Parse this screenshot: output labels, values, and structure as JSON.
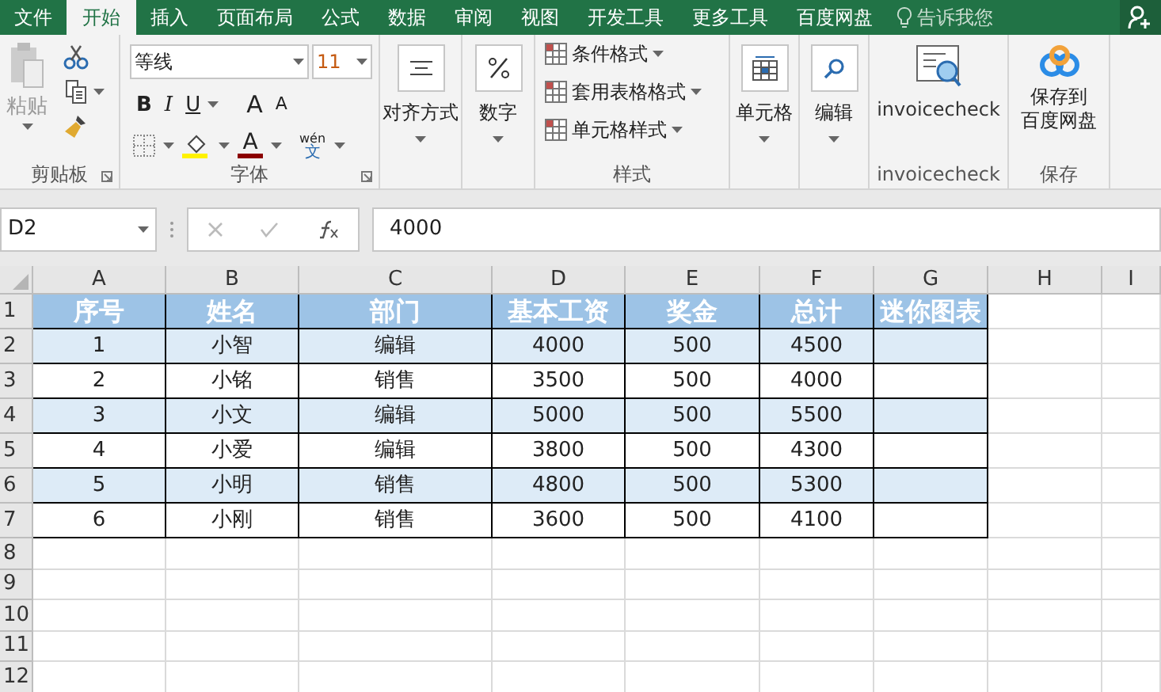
{
  "tabs": [
    {
      "label": "文件",
      "selected": false
    },
    {
      "label": "开始",
      "selected": true
    },
    {
      "label": "插入",
      "selected": false
    },
    {
      "label": "页面布局",
      "selected": false
    },
    {
      "label": "公式",
      "selected": false
    },
    {
      "label": "数据",
      "selected": false
    },
    {
      "label": "审阅",
      "selected": false
    },
    {
      "label": "视图",
      "selected": false
    },
    {
      "label": "开发工具",
      "selected": false
    },
    {
      "label": "更多工具",
      "selected": false
    },
    {
      "label": "百度网盘",
      "selected": false
    }
  ],
  "tell_me": "告诉我您",
  "ribbon": {
    "clipboard": {
      "paste": "粘贴",
      "label": "剪贴板"
    },
    "font": {
      "name": "等线",
      "size": "11",
      "bold": "B",
      "italic": "I",
      "underline": "U",
      "grow": "A",
      "shrink": "A",
      "font_color": "A",
      "phonetic_top": "wén",
      "phonetic_bottom": "文",
      "label": "字体"
    },
    "alignment": "对齐方式",
    "number": "数字",
    "styles": {
      "items": [
        "条件格式",
        "套用表格格式",
        "单元格样式"
      ],
      "label": "样式"
    },
    "cells": "单元格",
    "editing": "编辑",
    "invoicecheck": {
      "button": "invoicecheck",
      "label": "invoicecheck"
    },
    "save": {
      "button_line1": "保存到",
      "button_line2": "百度网盘",
      "label": "保存"
    }
  },
  "formula_bar": {
    "name_box": "D2",
    "value": "4000"
  },
  "sheet": {
    "columns": [
      "A",
      "B",
      "C",
      "D",
      "E",
      "F",
      "G",
      "H",
      "I"
    ],
    "row_numbers": [
      "1",
      "2",
      "3",
      "4",
      "5",
      "6",
      "7",
      "8",
      "9",
      "10",
      "11",
      "12"
    ],
    "header": [
      "序号",
      "姓名",
      "部门",
      "基本工资",
      "奖金",
      "总计",
      "迷你图表"
    ],
    "rows": [
      [
        "1",
        "小智",
        "编辑",
        "4000",
        "500",
        "4500"
      ],
      [
        "2",
        "小铭",
        "销售",
        "3500",
        "500",
        "4000"
      ],
      [
        "3",
        "小文",
        "编辑",
        "5000",
        "500",
        "5500"
      ],
      [
        "4",
        "小爱",
        "编辑",
        "3800",
        "500",
        "4300"
      ],
      [
        "5",
        "小明",
        "销售",
        "4800",
        "500",
        "5300"
      ],
      [
        "6",
        "小刚",
        "销售",
        "3600",
        "500",
        "4100"
      ]
    ]
  }
}
